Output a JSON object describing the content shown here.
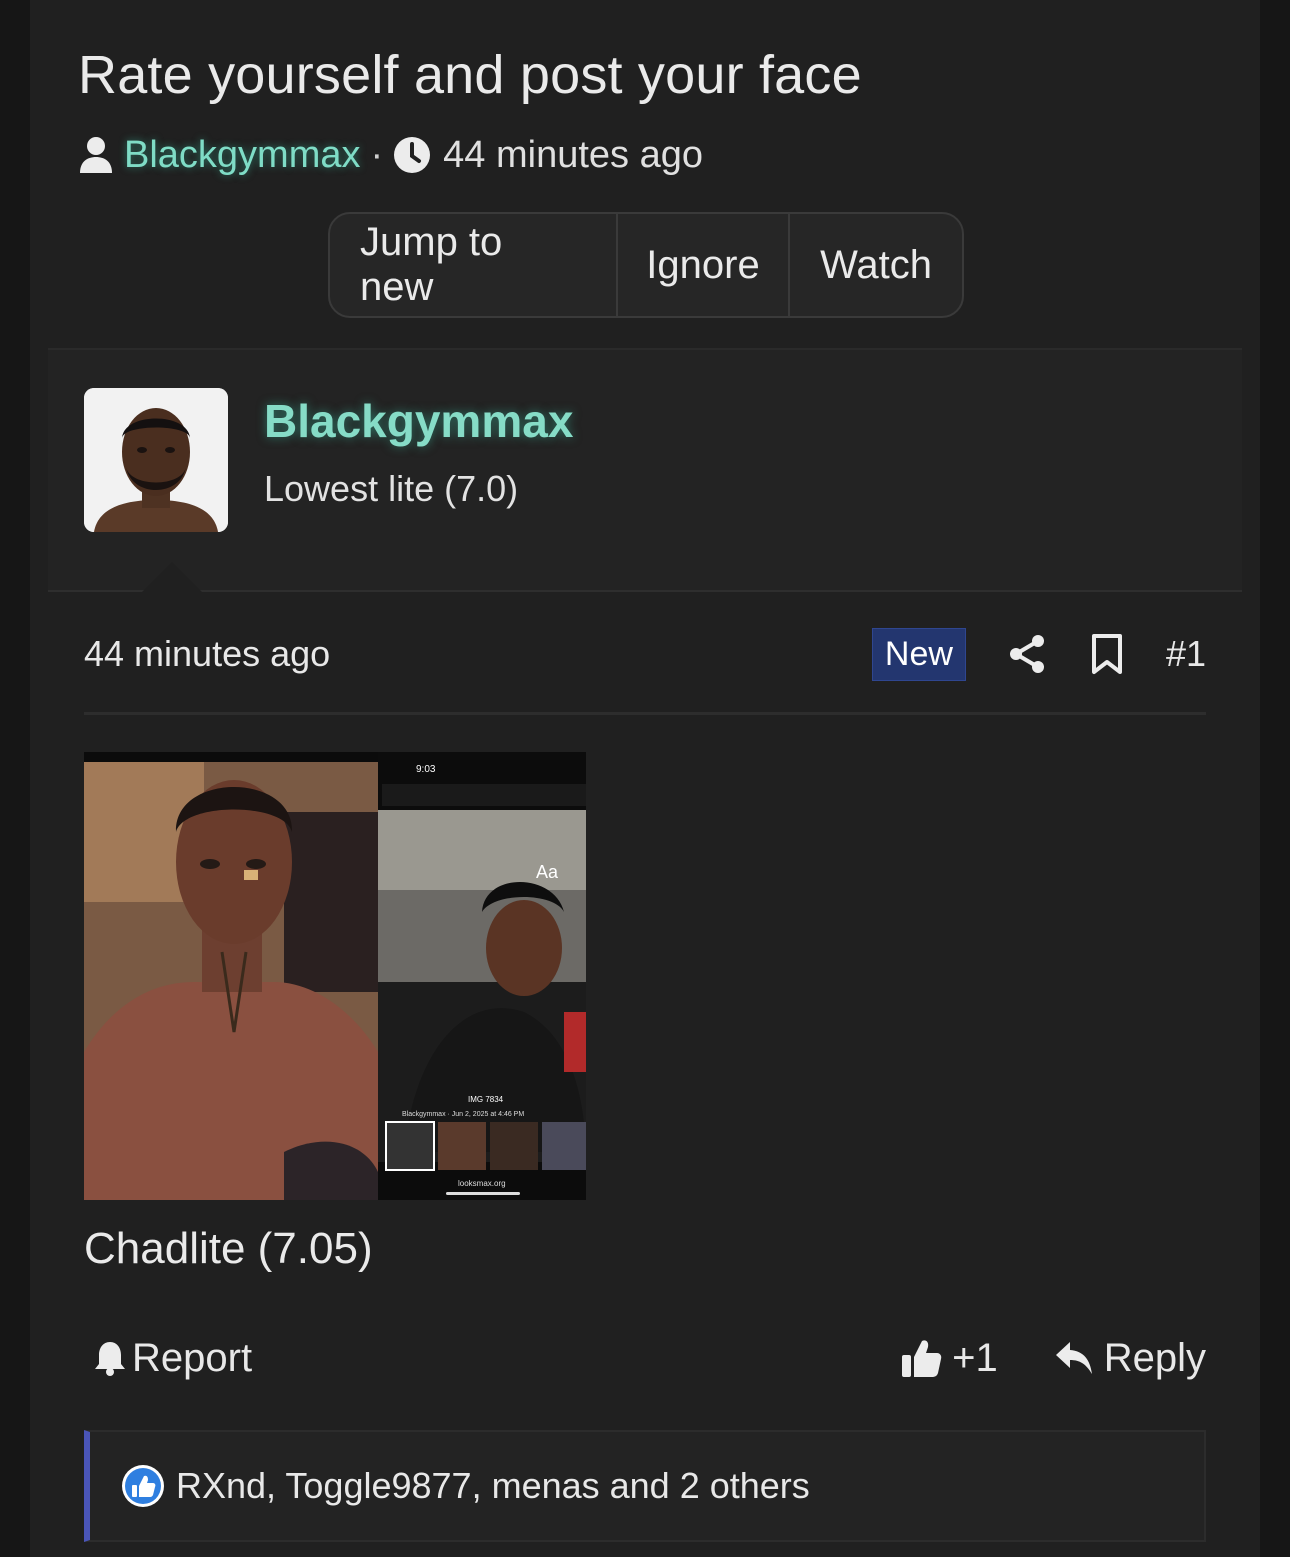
{
  "thread": {
    "title": "Rate yourself and post your face",
    "author": "Blackgymmax",
    "separator": "·",
    "time": "44 minutes ago"
  },
  "thread_actions": {
    "jump_label": "Jump to new",
    "ignore_label": "Ignore",
    "watch_label": "Watch"
  },
  "post": {
    "author": "Blackgymmax",
    "user_title": "Lowest lite (7.0)",
    "time": "44 minutes ago",
    "new_badge": "New",
    "post_number": "#1",
    "body": "Chadlite (7.05)",
    "attachment": {
      "status_time": "9:03",
      "img_caption": "IMG 7834",
      "img_meta": "Blackgymmax · Jun 2, 2025 at 4:46 PM",
      "url": "looksmax.org",
      "text_tool": "Aa"
    },
    "actions": {
      "report_label": "Report",
      "like_label": "+1",
      "reply_label": "Reply"
    },
    "reactions_text": "RXnd, Toggle9877, menas and 2 others"
  },
  "colors": {
    "accent_user": "#7fdcc6",
    "new_badge": "#23366f",
    "reaction_bar": "#4a55b8",
    "like_blue": "#2f7fe0"
  }
}
